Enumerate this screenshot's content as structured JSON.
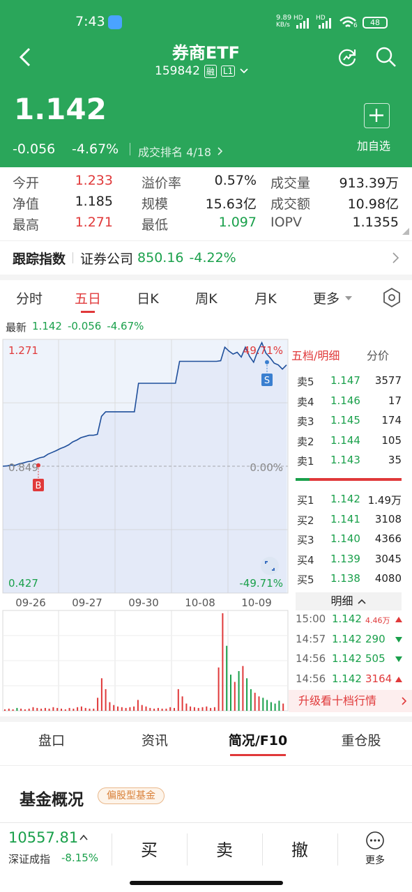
{
  "status_bar": {
    "time": "7:43",
    "net_speed": "9.89",
    "net_unit": "KB/s",
    "hd1": "HD",
    "hd2": "HD",
    "wifi_num": "6",
    "battery": "48"
  },
  "header": {
    "title": "券商ETF",
    "code": "159842",
    "badge_rong": "融",
    "badge_level": "L1"
  },
  "quote": {
    "price": "1.142",
    "change": "-0.056",
    "change_pct": "-4.67%",
    "rank_label": "成交排名 4/18",
    "add_watch": "加自选"
  },
  "stats": [
    {
      "l1": "今开",
      "v1": "1.233",
      "c1": "red",
      "l2": "溢价率",
      "v2": "0.57%",
      "c2": "dark",
      "l3": "成交量",
      "v3": "913.39万",
      "c3": "dark"
    },
    {
      "l1": "净值",
      "v1": "1.185",
      "c1": "dark",
      "l2": "规模",
      "v2": "15.63亿",
      "c2": "dark",
      "l3": "成交额",
      "v3": "10.98亿",
      "c3": "dark"
    },
    {
      "l1": "最高",
      "v1": "1.271",
      "c1": "red",
      "l2": "最低",
      "v2": "1.097",
      "c2": "green",
      "l3": "IOPV",
      "v3": "1.1355",
      "c3": "dark"
    }
  ],
  "tracking": {
    "label": "跟踪指数",
    "index_name": "证券公司",
    "index_value": "850.16",
    "index_pct": "-4.22%"
  },
  "chart_tabs": [
    "分时",
    "五日",
    "日K",
    "周K",
    "月K",
    "更多"
  ],
  "chart_tab_active": 1,
  "latest": {
    "label": "最新",
    "price": "1.142",
    "change": "-0.056",
    "pct": "-4.67%"
  },
  "colors": {
    "brand_green": "#2aa65a",
    "up_red": "#e0393a",
    "down_green": "#1aa04b",
    "line_blue": "#1f4f9b"
  },
  "chart_data": {
    "type": "line",
    "title": "",
    "x_labels": [
      "09-26",
      "09-27",
      "09-30",
      "10-08",
      "10-09"
    ],
    "y_top_label": "1.271",
    "y_bottom_label": "0.427",
    "y_mid_label": "0.849",
    "pct_top_label": "49.71%",
    "pct_mid_label": "0.00%",
    "pct_bottom_label": "-49.71%",
    "ylim": [
      0.427,
      1.271
    ],
    "markers": [
      {
        "label": "B",
        "color": "#e0393a"
      },
      {
        "label": "S",
        "color": "#3a7fd0"
      }
    ],
    "series": [
      {
        "values": [
          0.849,
          0.85,
          0.853,
          0.852,
          0.857,
          0.86,
          0.864,
          0.866,
          0.872,
          0.877,
          0.88,
          0.889,
          0.895,
          0.901,
          0.908,
          0.913,
          0.92,
          0.93,
          0.936,
          0.944,
          0.948,
          0.952,
          0.952,
          0.955,
          1.015,
          1.03,
          1.03,
          1.03,
          1.03,
          1.03,
          1.03,
          1.03,
          1.03,
          1.125,
          1.125,
          1.125,
          1.125,
          1.125,
          1.125,
          1.125,
          1.125,
          1.125,
          1.125,
          1.198,
          1.198,
          1.198,
          1.198,
          1.198,
          1.198,
          1.198,
          1.198,
          1.198,
          1.198,
          1.2,
          1.245,
          1.232,
          1.222,
          1.228,
          1.212,
          1.245,
          1.215,
          1.195,
          1.232,
          1.26,
          1.225,
          1.21,
          1.192,
          1.186,
          1.172,
          1.186
        ]
      }
    ],
    "volume": [
      2,
      3,
      2,
      4,
      3,
      2,
      3,
      5,
      4,
      3,
      4,
      3,
      5,
      4,
      3,
      2,
      4,
      3,
      5,
      6,
      4,
      3,
      3,
      18,
      45,
      30,
      12,
      8,
      6,
      5,
      4,
      5,
      6,
      15,
      8,
      6,
      4,
      3,
      4,
      3,
      3,
      5,
      4,
      30,
      20,
      10,
      6,
      5,
      4,
      5,
      6,
      4,
      5,
      60,
      135,
      90,
      50,
      40,
      55,
      62,
      45,
      30,
      25,
      20,
      18,
      15,
      12,
      10,
      14,
      10
    ]
  },
  "orderbook": {
    "tab_active": "五档/明细",
    "tab_other": "分价",
    "asks": [
      {
        "label": "卖5",
        "price": "1.147",
        "vol": "3577"
      },
      {
        "label": "卖4",
        "price": "1.146",
        "vol": "17"
      },
      {
        "label": "卖3",
        "price": "1.145",
        "vol": "174"
      },
      {
        "label": "卖2",
        "price": "1.144",
        "vol": "105"
      },
      {
        "label": "卖1",
        "price": "1.143",
        "vol": "35"
      }
    ],
    "bids": [
      {
        "label": "买1",
        "price": "1.142",
        "vol": "1.49万"
      },
      {
        "label": "买2",
        "price": "1.141",
        "vol": "3108"
      },
      {
        "label": "买3",
        "price": "1.140",
        "vol": "4366"
      },
      {
        "label": "买4",
        "price": "1.139",
        "vol": "3045"
      },
      {
        "label": "买5",
        "price": "1.138",
        "vol": "4080"
      }
    ],
    "detail_label": "明细",
    "trades": [
      {
        "time": "15:00",
        "price": "1.142",
        "vol": "4.46万",
        "dir": "up"
      },
      {
        "time": "14:57",
        "price": "1.142",
        "vol": "290",
        "dir": "down"
      },
      {
        "time": "14:56",
        "price": "1.142",
        "vol": "505",
        "dir": "down"
      },
      {
        "time": "14:56",
        "price": "1.142",
        "vol": "3164",
        "dir": "up"
      }
    ],
    "upgrade": "升级看十档行情"
  },
  "bottom_tabs": [
    "盘口",
    "资讯",
    "简况/F10",
    "重仓股"
  ],
  "bottom_tab_active": 2,
  "fund": {
    "title": "基金概况",
    "tag": "偏股型基金"
  },
  "footer": {
    "index_value": "10557.81",
    "index_name": "深证成指",
    "index_pct": "-8.15%",
    "buy": "买",
    "sell": "卖",
    "cancel": "撤",
    "more": "更多"
  }
}
